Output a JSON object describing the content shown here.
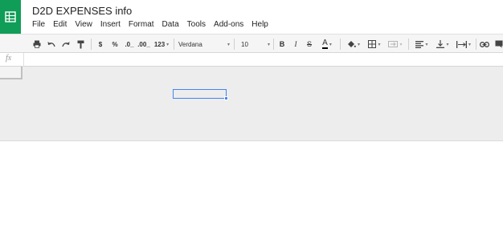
{
  "document": {
    "title": "D2D EXPENSES info"
  },
  "menu": [
    "File",
    "Edit",
    "View",
    "Insert",
    "Format",
    "Data",
    "Tools",
    "Add-ons",
    "Help"
  ],
  "toolbar": {
    "currency_label": "$",
    "percent_label": "%",
    "decrease_decimals_label": ".0_",
    "increase_decimals_label": ".00_",
    "more_formats_label": "123",
    "font_family_value": "Verdana",
    "font_size_value": "10",
    "bold_label": "B",
    "italic_label": "I",
    "strikethrough_label": "S",
    "text_color_label": "A"
  },
  "formula_bar": {
    "fx_label": "fx"
  },
  "colors": {
    "brand": "#0f9d58",
    "selection": "#4285f4"
  }
}
